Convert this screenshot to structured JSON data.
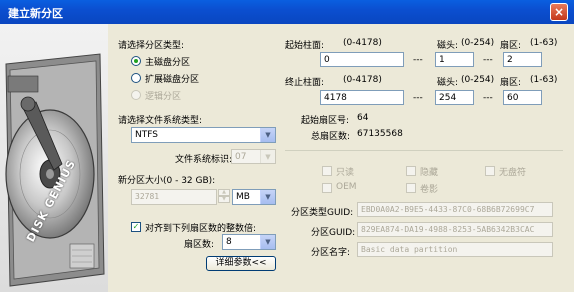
{
  "window": {
    "title": "建立新分区",
    "close": "×"
  },
  "art": {
    "brand": "DISK GENIUS"
  },
  "partition_type": {
    "label": "请选择分区类型:",
    "options": [
      {
        "label": "主磁盘分区",
        "selected": true,
        "enabled": true
      },
      {
        "label": "扩展磁盘分区",
        "selected": false,
        "enabled": true
      },
      {
        "label": "逻辑分区",
        "selected": false,
        "enabled": false
      }
    ]
  },
  "filesystem": {
    "label": "请选择文件系统类型:",
    "value": "NTFS"
  },
  "fs_id": {
    "label": "文件系统标识:",
    "value": "07"
  },
  "size": {
    "label": "新分区大小(0 - 32 GB):",
    "value": "32781",
    "unit": "MB"
  },
  "align": {
    "label": "对齐到下列扇区数的整数倍:",
    "checked": true,
    "sectors_label": "扇区数:",
    "sectors_value": "8"
  },
  "details_button": "详细参数<<",
  "start": {
    "label": "起始柱面:",
    "range": "(0-4178)",
    "value": "0",
    "head_label": "磁头:",
    "head_range": "(0-254)",
    "head_value": "1",
    "sector_label": "扇区:",
    "sector_range": "(1-63)",
    "sector_value": "2",
    "dash": "---"
  },
  "end": {
    "label": "终止柱面:",
    "range": "(0-4178)",
    "value": "4178",
    "head_label": "磁头:",
    "head_range": "(0-254)",
    "head_value": "254",
    "sector_label": "扇区:",
    "sector_range": "(1-63)",
    "sector_value": "60",
    "dash": "---"
  },
  "start_sector": {
    "label": "起始扇区号:",
    "value": "64"
  },
  "total_sectors": {
    "label": "总扇区数:",
    "value": "67135568"
  },
  "attributes": [
    {
      "label": "只读"
    },
    {
      "label": "隐藏"
    },
    {
      "label": "无盘符"
    },
    {
      "label": "OEM"
    },
    {
      "label": "卷影"
    }
  ],
  "type_guid": {
    "label": "分区类型GUID:",
    "value": "EBD0A0A2-B9E5-4433-87C0-68B6B72699C7"
  },
  "part_guid": {
    "label": "分区GUID:",
    "value": "829EA874-DA19-4988-8253-5AB6342B3CAC"
  },
  "part_name": {
    "label": "分区名字:",
    "value": "Basic data partition"
  },
  "colors": {
    "title_bar": "#0a5fe0",
    "dialog_bg": "#ece9d8",
    "close_button": "#d9542c"
  }
}
